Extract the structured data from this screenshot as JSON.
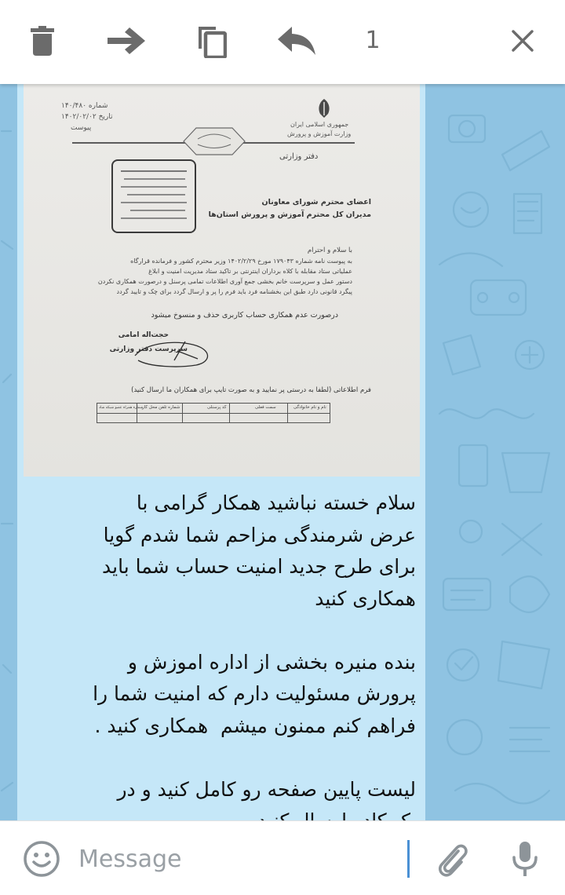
{
  "toolbar": {
    "delete_icon": "trash-icon",
    "forward_icon": "arrow-right-icon",
    "copy_icon": "copy-icon",
    "reply_icon": "reply-icon",
    "selected_count": "1",
    "close_icon": "close-icon"
  },
  "message": {
    "photo_doc": {
      "ref_number": "شماره ۱۴۰/۴۸۰",
      "ref_date": "تاریخ ۱۴۰۲/۰۲/۰۲",
      "ref_attach": "پیوست",
      "emblem_line1": "جمهوری اسلامی ایران",
      "emblem_line2": "وزارت آموزش و پرورش",
      "office": "دفتر وزارتی",
      "recipient1": "اعضای محترم شورای معاونان",
      "recipient2": "مدیران کل محترم آموزش و پرورش استان‌ها",
      "greeting": "با سلام و احترام",
      "body1": "به پیوست نامه شماره ۱۷۹۰۴۳ مورخ ۱۴۰۲/۲/۲۹ وزیر محترم کشور و فرمانده قرارگاه",
      "body2": "عملیاتی ستاد مقابله با کلاه برداران اینترنتی بر تاکید ستاد مدیریت امنیت و ابلاغ",
      "body3": "دستور عمل و سرپرست خانم بخشی جمع آوری اطلاعات تمامی پرسنل و درصورت همکاری نکردن",
      "body4": "پیگرد قانونی دارد طبق این بخشنامه فرد باید فرم را پر و ارسال گردد برای چک و تایید گردد",
      "warning": "درصورت عدم همکاری حساب کاربری حذف و منسوخ میشود",
      "signer_name": "حجت‌اله امامی",
      "signer_title": "سرپرست دفتر وزارتی",
      "form_note": "فرم اطلاعاتی (لطفا به درستی پر نمایید و به صورت تایپ برای همکاران ما ارسال کنید)",
      "table_headers": [
        "نام و نام خانوادگی",
        "سمت فعلی",
        "کد پرسنلی",
        "شماره تلفن محل کار",
        "شماره همراه عضو شبکه شاد"
      ]
    },
    "caption": "سلام خسته نباشید همکار گرامی با\nعرض شرمندگی مزاحم شما شدم گویا\nبرای طرح جدید امنیت حساب شما باید\nهمکاری کنید\n\nبنده منیره بخشی از اداره اموزش و\nپرورش مسئولیت دارم که امنیت شما را\nفراهم کنم ممنون میشم  همکاری کنید .\n\nلیست پایین صفحه رو کامل کنید و در\nیک کادر ارسال کنید"
  },
  "input": {
    "emoji_icon": "smiley-icon",
    "placeholder": "Message",
    "attach_icon": "paperclip-icon",
    "mic_icon": "microphone-icon"
  },
  "colors": {
    "wallpaper": "#8fc3e2",
    "bubble": "#c5e7f8",
    "toolbar_icon": "#6b6b6b",
    "caret": "#4a90d4"
  }
}
